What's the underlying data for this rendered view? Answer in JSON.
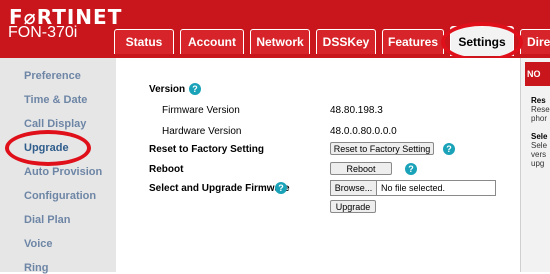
{
  "brand": {
    "logo": "F⌀RTINET",
    "model": "FON-370i"
  },
  "tabs": [
    {
      "label": "Status"
    },
    {
      "label": "Account"
    },
    {
      "label": "Network"
    },
    {
      "label": "DSSKey"
    },
    {
      "label": "Features"
    },
    {
      "label": "Settings"
    },
    {
      "label": "Dire"
    }
  ],
  "sidebar": {
    "items": [
      {
        "label": "Preference"
      },
      {
        "label": "Time & Date"
      },
      {
        "label": "Call Display"
      },
      {
        "label": "Upgrade"
      },
      {
        "label": "Auto Provision"
      },
      {
        "label": "Configuration"
      },
      {
        "label": "Dial Plan"
      },
      {
        "label": "Voice"
      },
      {
        "label": "Ring"
      }
    ]
  },
  "main": {
    "version_label": "Version",
    "firmware_label": "Firmware Version",
    "firmware_value": "48.80.198.3",
    "hardware_label": "Hardware Version",
    "hardware_value": "48.0.0.80.0.0.0",
    "reset_label": "Reset to Factory Setting",
    "reset_button": "Reset to Factory Setting",
    "reboot_label": "Reboot",
    "reboot_button": "Reboot",
    "select_label": "Select and Upgrade Firmware",
    "browse_button": "Browse...",
    "file_status": "No file selected.",
    "upgrade_button": "Upgrade",
    "help_glyph": "?"
  },
  "right_panel": {
    "header": "NO",
    "lines": [
      "Res",
      "Rese",
      "phor",
      "Sele",
      "Sele",
      "vers",
      "upg"
    ]
  },
  "colors": {
    "brand_red": "#c8161c",
    "annotation_red": "#e0101b",
    "help_teal": "#1aa3b8"
  }
}
